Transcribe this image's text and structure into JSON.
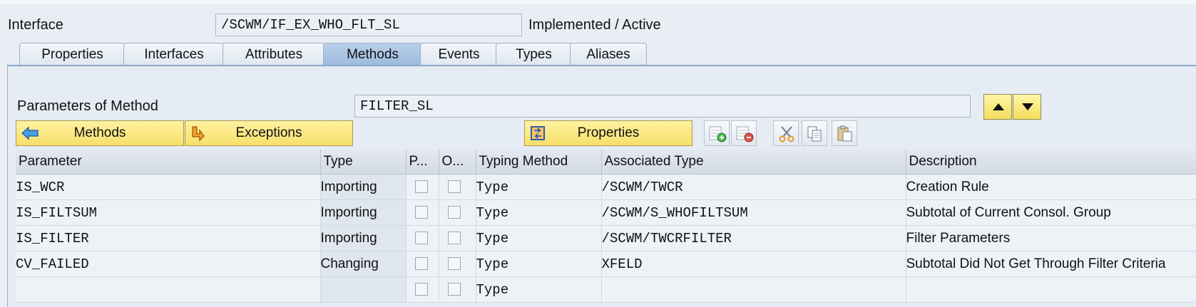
{
  "header": {
    "interface_label": "Interface",
    "interface_value": "/SCWM/IF_EX_WHO_FLT_SL",
    "status": "Implemented / Active"
  },
  "tabs": [
    {
      "label": "Properties",
      "active": false
    },
    {
      "label": "Interfaces",
      "active": false
    },
    {
      "label": "Attributes",
      "active": false
    },
    {
      "label": "Methods",
      "active": true
    },
    {
      "label": "Events",
      "active": false
    },
    {
      "label": "Types",
      "active": false
    },
    {
      "label": "Aliases",
      "active": false
    }
  ],
  "method": {
    "label": "Parameters of Method",
    "value": "FILTER_SL"
  },
  "toolbar": {
    "methods_label": "Methods",
    "exceptions_label": "Exceptions",
    "properties_label": "Properties"
  },
  "grid": {
    "columns": [
      "Parameter",
      "Type",
      "P...",
      "O...",
      "Typing Method",
      "Associated Type",
      "Description"
    ],
    "rows": [
      {
        "parameter": "IS_WCR",
        "type": "Importing",
        "typing": "Type",
        "assoc": "/SCWM/TWCR",
        "desc": "Creation Rule"
      },
      {
        "parameter": "IS_FILTSUM",
        "type": "Importing",
        "typing": "Type",
        "assoc": "/SCWM/S_WHOFILTSUM",
        "desc": "Subtotal of Current Consol. Group"
      },
      {
        "parameter": "IS_FILTER",
        "type": "Importing",
        "typing": "Type",
        "assoc": "/SCWM/TWCRFILTER",
        "desc": "Filter Parameters"
      },
      {
        "parameter": "CV_FAILED",
        "type": "Changing",
        "typing": "Type",
        "assoc": "XFELD",
        "desc": "Subtotal Did Not Get Through Filter Criteria"
      },
      {
        "parameter": "",
        "type": "",
        "typing": "Type",
        "assoc": "",
        "desc": ""
      }
    ]
  },
  "colors": {
    "accent_tab": "#9dbbde",
    "button_yellow": "#f7df6a",
    "icon_blue": "#2f7fd0",
    "icon_orange": "#e08a1a"
  }
}
